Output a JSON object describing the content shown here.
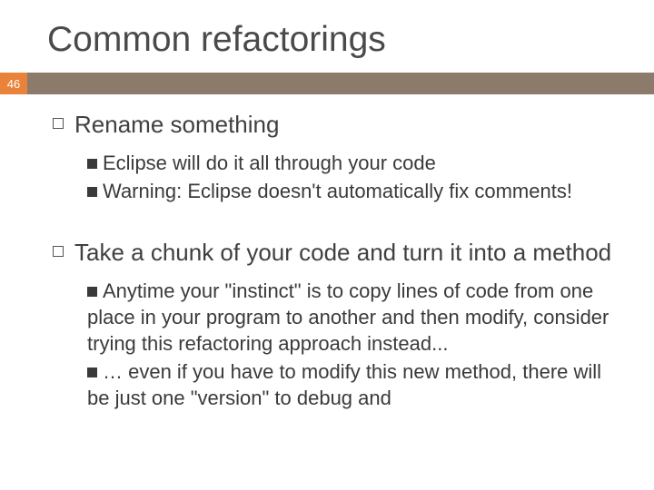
{
  "slide": {
    "title": "Common refactorings",
    "number": "46",
    "bullets": [
      {
        "text": "Rename something",
        "subs": [
          {
            "lead": "Eclipse",
            "rest": " will do it all through your code"
          },
          {
            "lead": "Warning:",
            "rest": " Eclipse doesn't automatically fix comments!"
          }
        ]
      },
      {
        "text": "Take a chunk of your code and turn it into a method",
        "subs": [
          {
            "lead": "Anytime",
            "rest": " your \"instinct\" is to copy lines of code from one place in your program to another and then modify, consider trying this refactoring approach instead..."
          },
          {
            "lead": "…",
            "rest": " even if you have to modify this new method, there will be just one \"version\" to debug and"
          }
        ]
      }
    ]
  }
}
